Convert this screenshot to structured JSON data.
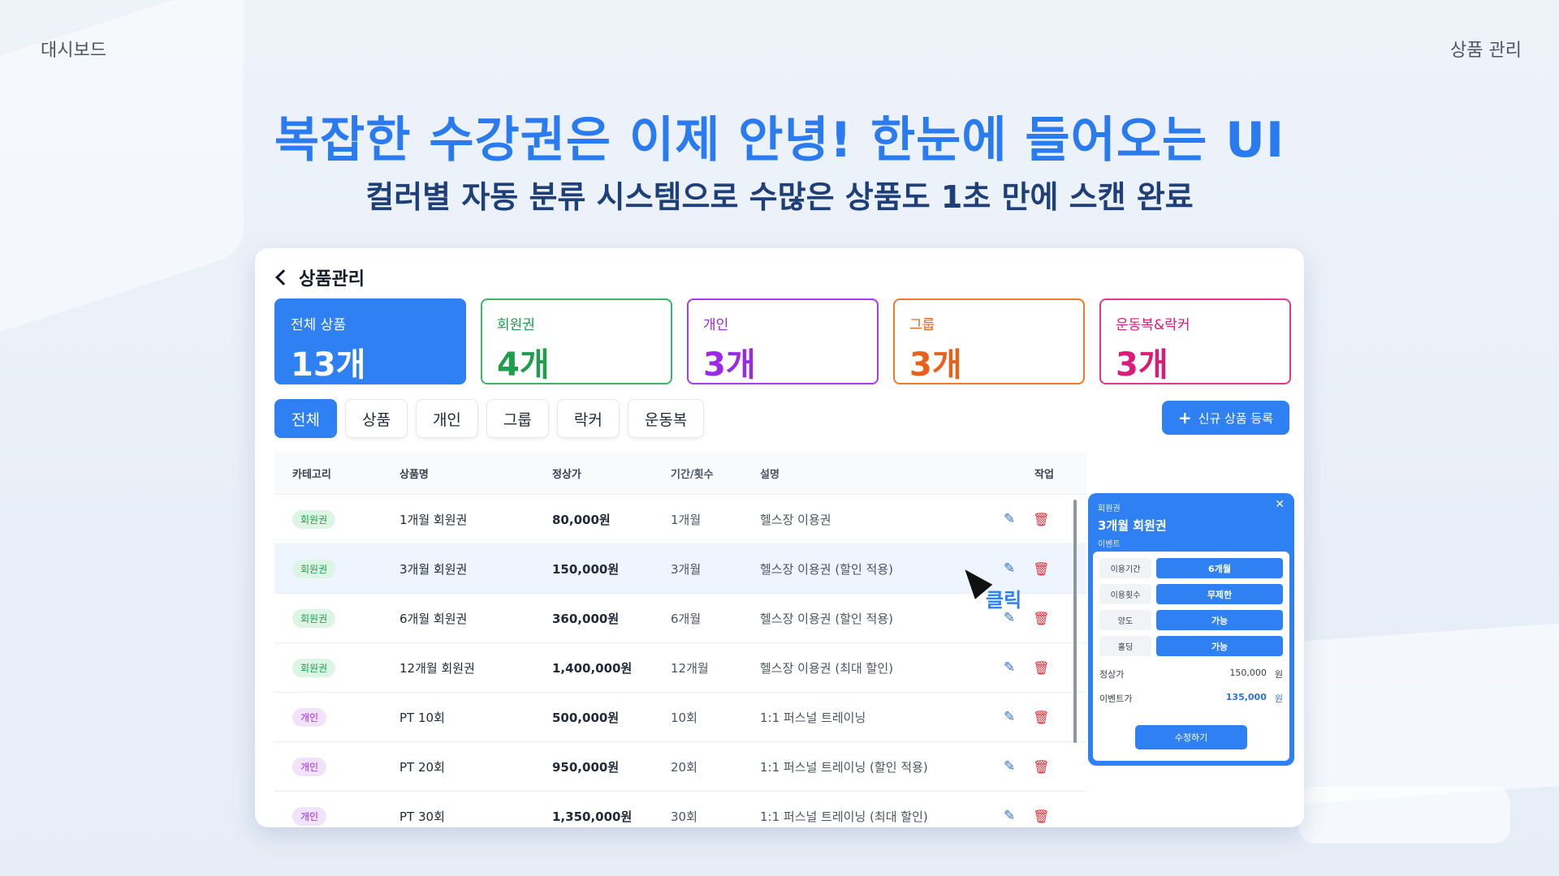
{
  "top": {
    "left_label": "대시보드",
    "right_label": "상품 관리"
  },
  "hero": {
    "headline": "복잡한 수강권은 이제 안녕! 한눈에 들어오는 UI",
    "subline": "컬러별 자동 분류 시스템으로 수많은 상품도 1초 만에 스캔 완료"
  },
  "panel": {
    "title": "상품관리",
    "cards": [
      {
        "label": "전체 상품",
        "value": "13개"
      },
      {
        "label": "회원권",
        "value": "4개"
      },
      {
        "label": "개인",
        "value": "3개"
      },
      {
        "label": "그룹",
        "value": "3개"
      },
      {
        "label": "운동복&락커",
        "value": "3개"
      }
    ],
    "filters": [
      "전체",
      "상품",
      "개인",
      "그룹",
      "락커",
      "운동복"
    ],
    "active_filter": "전체",
    "add_button": "신규 상품 등록",
    "table": {
      "headers": [
        "카테고리",
        "상품명",
        "정상가",
        "기간/횟수",
        "설명",
        "작업"
      ],
      "rows": [
        {
          "cat": "회원권",
          "name": "1개월 회원권",
          "price": "80,000원",
          "period": "1개월",
          "desc": "헬스장 이용권"
        },
        {
          "cat": "회원권",
          "name": "3개월 회원권",
          "price": "150,000원",
          "period": "3개월",
          "desc": "헬스장 이용권 (할인 적용)"
        },
        {
          "cat": "회원권",
          "name": "6개월 회원권",
          "price": "360,000원",
          "period": "6개월",
          "desc": "헬스장 이용권 (할인 적용)"
        },
        {
          "cat": "회원권",
          "name": "12개월 회원권",
          "price": "1,400,000원",
          "period": "12개월",
          "desc": "헬스장 이용권 (최대 할인)"
        },
        {
          "cat": "개인",
          "name": "PT 10회",
          "price": "500,000원",
          "period": "10회",
          "desc": "1:1 퍼스널 트레이닝"
        },
        {
          "cat": "개인",
          "name": "PT 20회",
          "price": "950,000원",
          "period": "20회",
          "desc": "1:1 퍼스널 트레이닝 (할인 적용)"
        },
        {
          "cat": "개인",
          "name": "PT 30회",
          "price": "1,350,000원",
          "period": "30회",
          "desc": "1:1 퍼스널 트레이닝 (최대 할인)"
        }
      ]
    },
    "cursor_label": "클릭",
    "detail": {
      "category": "회원권",
      "name": "3개월 회원권",
      "tag": "이벤트",
      "options": [
        {
          "key": "이용기간",
          "value": "6개월"
        },
        {
          "key": "이용횟수",
          "value": "무제한"
        },
        {
          "key": "양도",
          "value": "가능"
        },
        {
          "key": "홀딩",
          "value": "가능"
        }
      ],
      "regular_label": "정상가",
      "regular_price": "150,000",
      "event_label": "이벤트가",
      "event_price": "135,000",
      "currency": "원",
      "edit_button": "수정하기"
    }
  },
  "icons": {
    "back": "chevron-left-icon",
    "edit": "pencil-icon",
    "delete": "trash-icon",
    "close": "close-icon",
    "plus": "plus-icon",
    "cursor": "mouse-pointer-icon"
  },
  "colors": {
    "accent": "#2f80f3",
    "membership": "#1f9c4c",
    "personal": "#9a2ae8",
    "group": "#e8601a",
    "locker": "#dc1a78",
    "delete": "#e0303a"
  }
}
